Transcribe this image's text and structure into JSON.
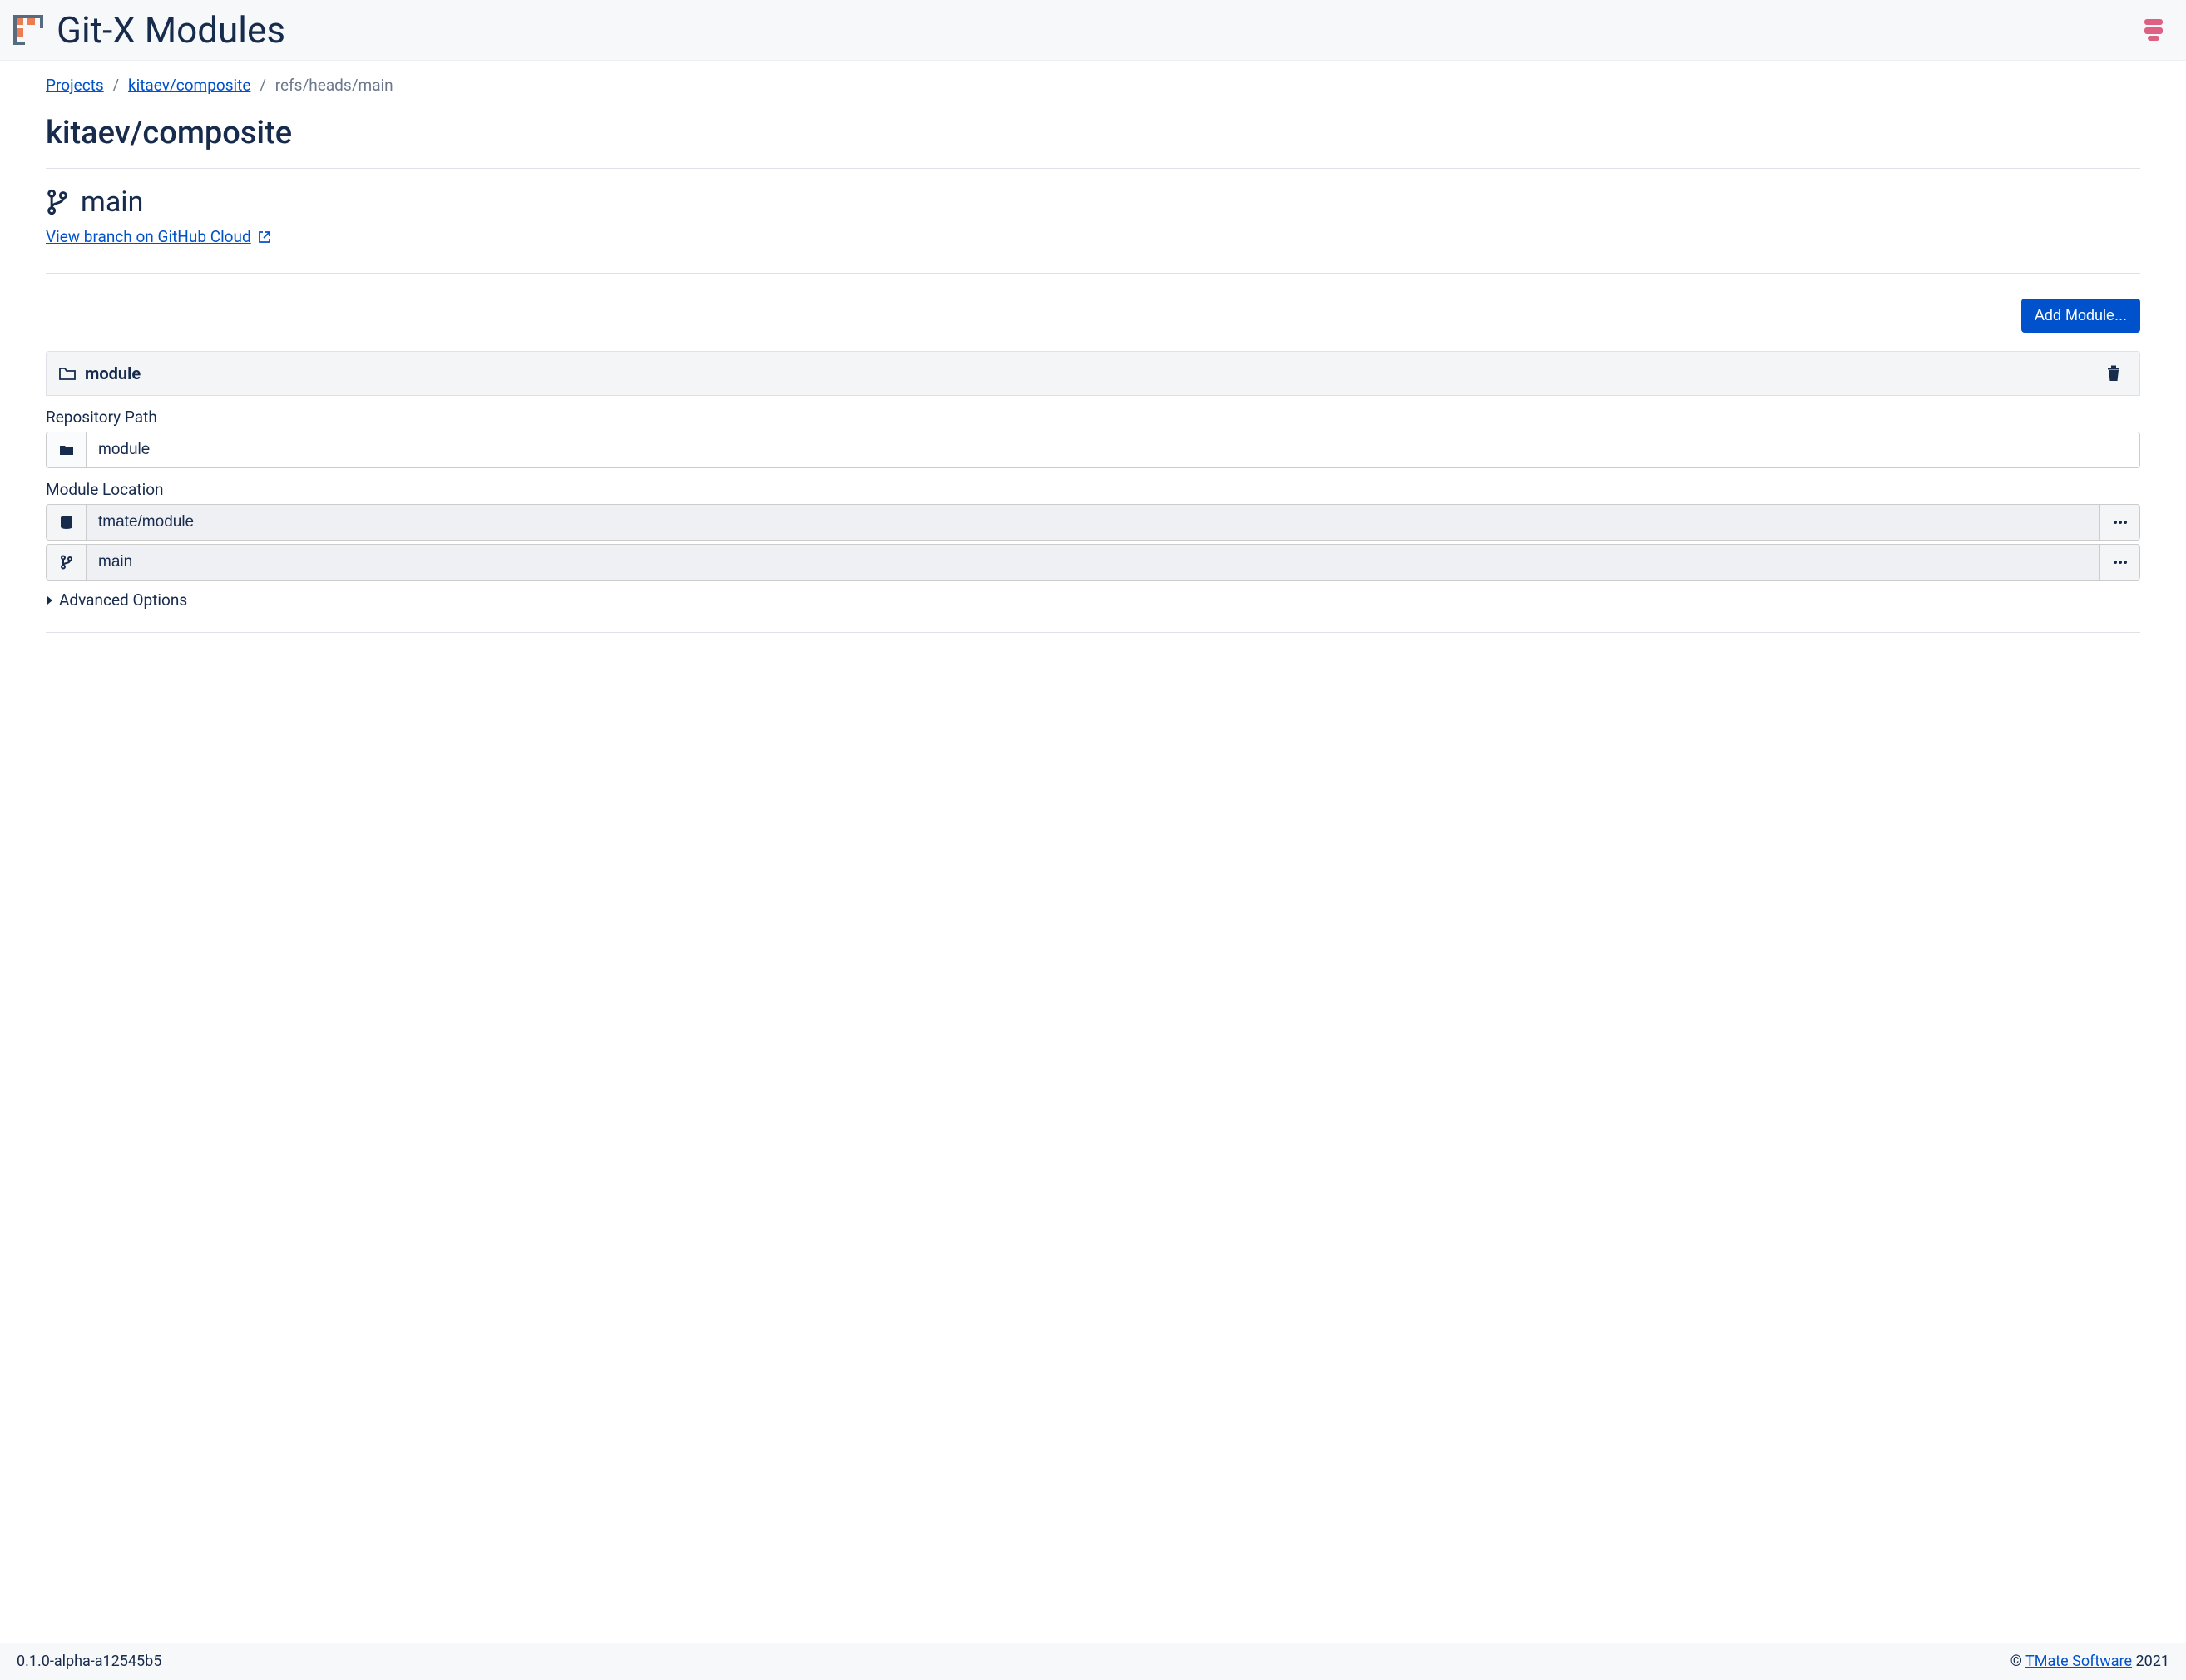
{
  "header": {
    "app_title": "Git-X Modules"
  },
  "breadcrumb": {
    "items": [
      {
        "label": "Projects",
        "link": true
      },
      {
        "label": "kitaev/composite",
        "link": true
      },
      {
        "label": "refs/heads/main",
        "link": false
      }
    ]
  },
  "page": {
    "title": "kitaev/composite",
    "branch": "main",
    "view_branch_label": "View branch on GitHub Cloud"
  },
  "actions": {
    "add_module_label": "Add Module..."
  },
  "module": {
    "header_name": "module",
    "fields": {
      "repository_path": {
        "label": "Repository Path",
        "value": "module"
      },
      "module_location": {
        "label": "Module Location",
        "repo": "tmate/module",
        "branch": "main"
      }
    },
    "advanced_label": "Advanced Options"
  },
  "footer": {
    "version": "0.1.0-alpha-a12545b5",
    "copyright_prefix": "© ",
    "company": "TMate Software",
    "year": " 2021"
  }
}
